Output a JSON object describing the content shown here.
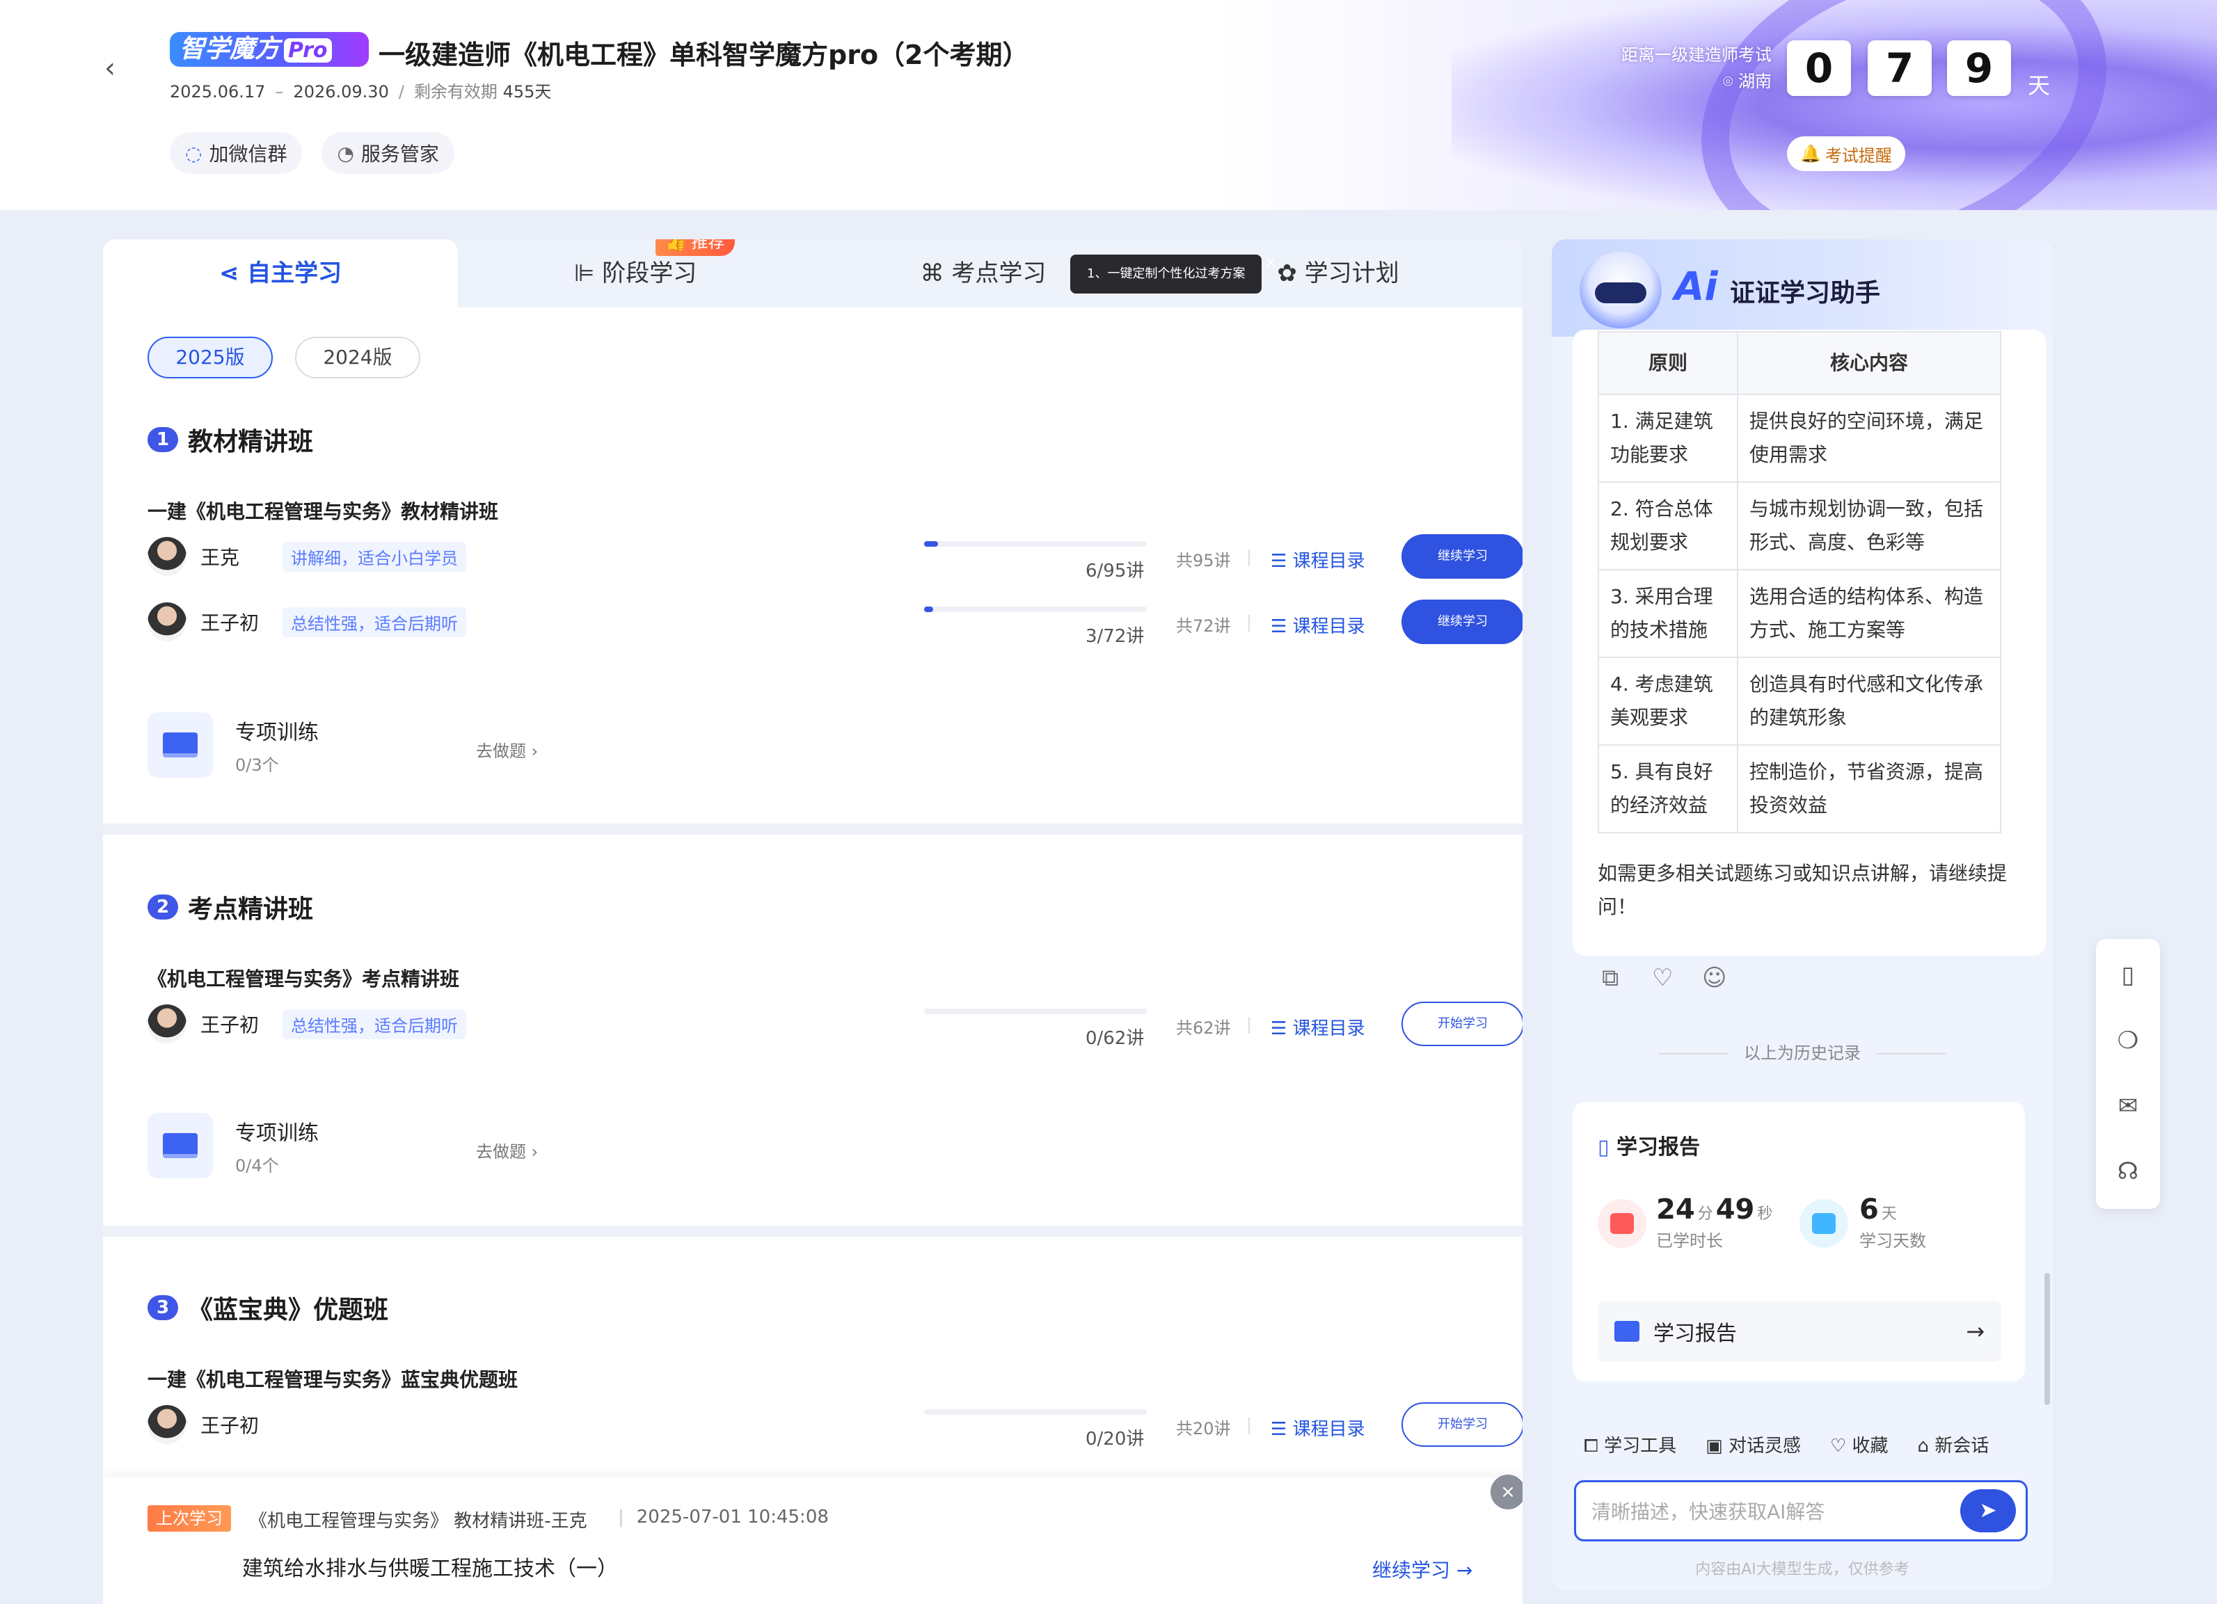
{
  "header": {
    "logo_text": "智学魔方",
    "logo_pro": "Pro",
    "title": "一级建造师《机电工程》单科智学魔方pro（2个考期）",
    "date_start": "2025.06.17",
    "date_sep": "–",
    "date_end": "2026.09.30",
    "slash": "/",
    "validity_label": "剩余有效期",
    "validity_value": "455天",
    "link_wechat": "加微信群",
    "link_service": "服务管家",
    "countdown_label": "距离一级建造师考试",
    "region": "湖南",
    "digits": [
      "0",
      "7",
      "9"
    ],
    "day_unit": "天",
    "remind": "考试提醒"
  },
  "tabs": {
    "self_study": "自主学习",
    "stage_study": "阶段学习",
    "recommend_badge": "推荐",
    "point_study": "考点学习",
    "tooltip": "1、一键定制个性化过考方案",
    "plan": "学习计划"
  },
  "versions": [
    "2025版",
    "2024版"
  ],
  "sections": [
    {
      "index": "1",
      "title": "教材精讲班",
      "course": "一建《机电工程管理与实务》教材精讲班",
      "teachers": [
        {
          "name": "王克",
          "tag": "讲解细，适合小白学员",
          "progress": "6/95讲",
          "pct": 6.3,
          "total": "共95讲",
          "catalog": "课程目录",
          "action": "继续学习"
        },
        {
          "name": "王子初",
          "tag": "总结性强，适合后期听",
          "progress": "3/72讲",
          "pct": 4.2,
          "total": "共72讲",
          "catalog": "课程目录",
          "action": "继续学习"
        }
      ],
      "drill": {
        "name": "专项训练",
        "count": "0/3个",
        "goto": "去做题"
      }
    },
    {
      "index": "2",
      "title": "考点精讲班",
      "course": "《机电工程管理与实务》考点精讲班",
      "teachers": [
        {
          "name": "王子初",
          "tag": "总结性强，适合后期听",
          "progress": "0/62讲",
          "pct": 0,
          "total": "共62讲",
          "catalog": "课程目录",
          "action": "开始学习"
        }
      ],
      "drill": {
        "name": "专项训练",
        "count": "0/4个",
        "goto": "去做题"
      }
    },
    {
      "index": "3",
      "title": "《蓝宝典》优题班",
      "course": "一建《机电工程管理与实务》蓝宝典优题班",
      "teachers": [
        {
          "name": "王子初",
          "tag": "",
          "progress": "0/20讲",
          "pct": 0,
          "total": "共20讲",
          "catalog": "课程目录",
          "action": "开始学习"
        }
      ]
    }
  ],
  "last_study": {
    "tag": "上次学习",
    "course": "《机电工程管理与实务》 教材精讲班-王克",
    "time": "2025-07-01 10:45:08",
    "lesson": "建筑给水排水与供暖工程施工技术（一）",
    "continue": "继续学习"
  },
  "assistant": {
    "ai_logo": "Ai",
    "title": "证证学习助手",
    "table_headers": [
      "原则",
      "核心内容"
    ],
    "table_rows": [
      [
        "1. 满足建筑功能要求",
        "提供良好的空间环境，满足使用需求"
      ],
      [
        "2. 符合总体规划要求",
        "与城市规划协调一致，包括形式、高度、色彩等"
      ],
      [
        "3. 采用合理的技术措施",
        "选用合适的结构体系、构造方式、施工方案等"
      ],
      [
        "4. 考虑建筑美观要求",
        "创造具有时代感和文化传承的建筑形象"
      ],
      [
        "5. 具有良好的经济效益",
        "控制造价，节省资源，提高投资效益"
      ]
    ],
    "note": "如需更多相关试题练习或知识点讲解，请继续提问！",
    "history": "以上为历史记录",
    "report_title": "学习报告",
    "stat_time": {
      "min": "24",
      "min_unit": "分",
      "sec": "49",
      "sec_unit": "秒",
      "label": "已学时长"
    },
    "stat_days": {
      "value": "6",
      "unit": "天",
      "label": "学习天数"
    },
    "report_link": "学习报告",
    "tools": [
      "学习工具",
      "对话灵感",
      "收藏",
      "新会话"
    ],
    "input_placeholder": "清晰描述，快速获取AI解答",
    "disclaimer": "内容由AI大模型生成，仅供参考"
  }
}
